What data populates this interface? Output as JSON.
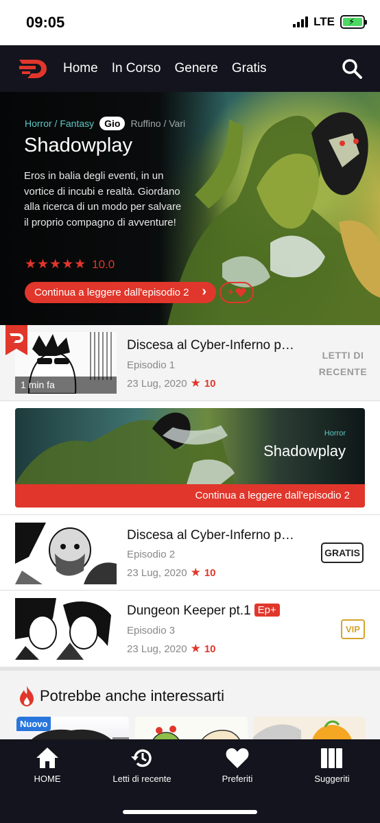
{
  "status": {
    "time": "09:05",
    "network": "LTE"
  },
  "nav": {
    "items": [
      "Home",
      "In Corso",
      "Genere",
      "Gratis"
    ]
  },
  "hero": {
    "genre": "Horror / Fantasy",
    "day": "Gio",
    "authors": "Ruffino / Vari",
    "title": "Shadowplay",
    "description": "Eros in balia degli eventi, in un vortice di incubi e realtà. Giordano alla ricerca di un modo per salvare il proprio compagno di avventure!",
    "stars": "★★★★★",
    "rating": "10.0",
    "cta": "Continua a leggere dall'episodio 2",
    "cta_arrow": "›",
    "fav_plus": "+"
  },
  "recent": {
    "title": "Discesa al Cyber-Inferno p…",
    "episode": "Episodio 1",
    "date": "23 Lug, 2020",
    "score": "10",
    "time_ago": "1 min fa",
    "tag": "LETTI DI RECENTE"
  },
  "banner": {
    "genre": "Horror",
    "title": "Shadowplay",
    "cta": "Continua a leggere dall'episodio 2"
  },
  "episodes": [
    {
      "title": "Discesa al Cyber-Inferno p…",
      "episode": "Episodio 2",
      "date": "23 Lug, 2020",
      "score": "10",
      "badge": "GRATIS"
    },
    {
      "title": "Dungeon Keeper pt.1",
      "title_badge": "Ep+",
      "episode": "Episodio 3",
      "date": "23 Lug, 2020",
      "score": "10",
      "badge": "VIP"
    }
  ],
  "suggest": {
    "title": "Potrebbe anche interessarti",
    "new_badge": "Nuovo"
  },
  "tabbar": {
    "items": [
      "HOME",
      "Letti di recente",
      "Preferiti",
      "Suggeriti"
    ]
  },
  "colors": {
    "accent": "#e1362b",
    "nav_bg": "#14141e",
    "genre_teal": "#5ec8c4",
    "vip_gold": "#d4a42c",
    "new_blue": "#2876dc"
  }
}
